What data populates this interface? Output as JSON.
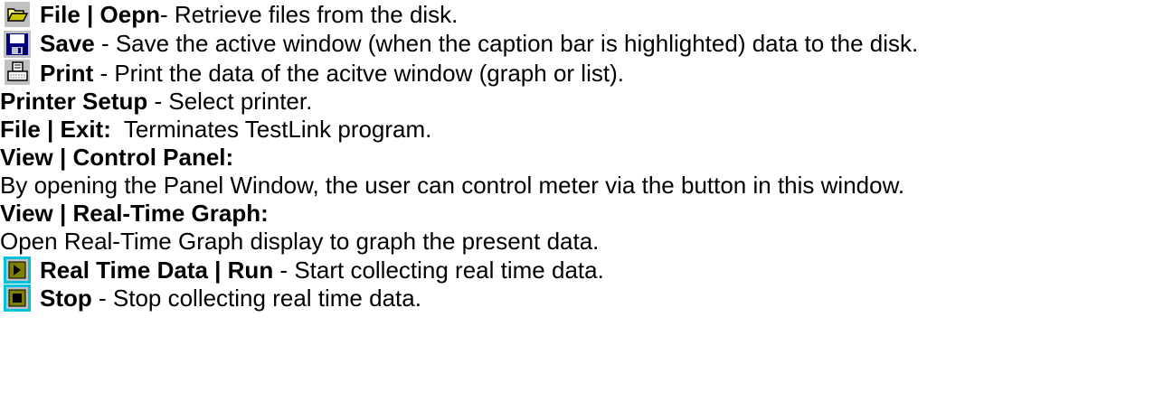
{
  "entries": [
    {
      "icon": "folder-open-icon",
      "term": "File | Oepn",
      "sep": "- ",
      "desc": "Retrieve files from the disk."
    },
    {
      "icon": "save-disk-icon",
      "term": "Save",
      "sep": " - ",
      "desc": "Save the active window (when the caption bar is highlighted) data to the disk."
    },
    {
      "icon": "printer-icon",
      "term": "Print",
      "sep": " - ",
      "desc": "Print the data of the acitve window (graph or list)."
    },
    {
      "term": "Printer Setup",
      "sep": " - ",
      "desc": "Select printer."
    },
    {
      "term": "File | Exit:",
      "sep": "  ",
      "desc": "Terminates TestLink program."
    },
    {
      "term": "View | Control Panel:"
    },
    {
      "desc": "By opening the Panel Window, the user can control meter via the button in this window."
    },
    {
      "term": "View | Real-Time Graph:"
    },
    {
      "desc": "Open Real-Time Graph display to graph the present data."
    },
    {
      "icon": "run-play-icon",
      "term": "Real Time Data | Run",
      "sep": " - ",
      "desc": "Start collecting real time data."
    },
    {
      "icon": "stop-icon",
      "term": "Stop",
      "sep": " - ",
      "desc": "Stop collecting real time data."
    }
  ]
}
